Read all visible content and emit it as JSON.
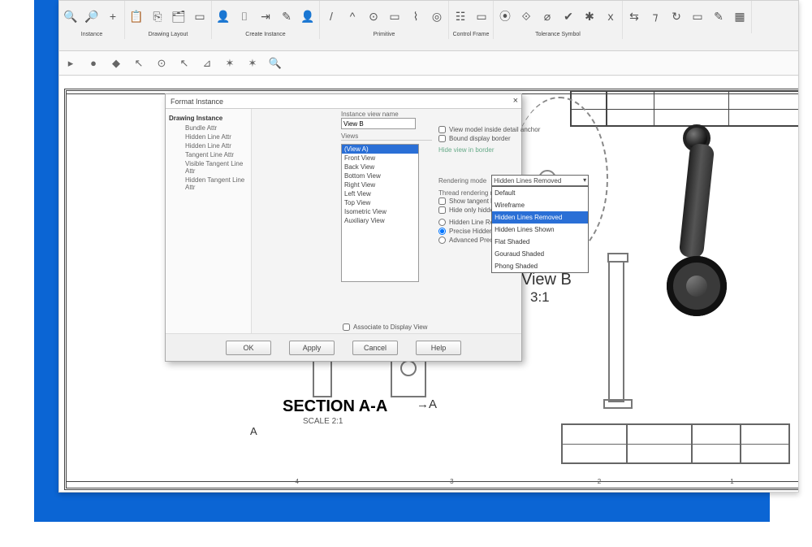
{
  "ribbon": {
    "groups": [
      {
        "label": "Instance",
        "items": [
          "🔍",
          "🔎",
          "+"
        ]
      },
      {
        "label": "Drawing Layout",
        "items": [
          "📋",
          "⎘",
          "🗂",
          "▭"
        ]
      },
      {
        "label": "Create Instance",
        "items": [
          "👤",
          "⌷",
          "⇥",
          "✎",
          "👤"
        ]
      },
      {
        "label": "Primitive",
        "items": [
          "/",
          "^",
          "⊙",
          "▭",
          "⌇",
          "◎"
        ]
      },
      {
        "label": "Control Frame",
        "items": [
          "☷",
          "▭"
        ]
      },
      {
        "label": "Tolerance Symbol",
        "items": [
          "⦿",
          "⟐",
          "⌀",
          "✔",
          "✱",
          "x"
        ]
      },
      {
        "label": "",
        "items": [
          "⇆",
          "⁊",
          "↻",
          "▭",
          "✎",
          "▦"
        ]
      }
    ]
  },
  "subtoolbar": [
    "●",
    "◆",
    "↖",
    "⊙",
    "↖",
    "⊿",
    "✶",
    "✶",
    "🔍"
  ],
  "dialog": {
    "title": "Format Instance",
    "tree_header": "Drawing Instance",
    "tree_items": [
      "Bundle Attr",
      "Hidden Line Attr",
      "Hidden Line Attr",
      "Tangent Line Attr",
      "Visible Tangent Line Attr",
      "Hidden Tangent Line Attr"
    ],
    "instance_name_label": "Instance view name",
    "instance_name_value": "View B",
    "view_list_label": "Views",
    "view_list": [
      "(View A)",
      "Front View",
      "Back View",
      "Bottom View",
      "Right View",
      "Left View",
      "Top View",
      "Isometric View",
      "Auxiliary View"
    ],
    "top_checks": [
      "View model inside detail anchor",
      "Bound display border"
    ],
    "top_links": [
      "Hide view in border"
    ],
    "render_mode_label": "Rendering mode",
    "render_mode_value": "Hidden Lines Removed",
    "render_options": [
      "Default",
      "Wireframe",
      "Hidden Lines Removed",
      "Hidden Lines Shown",
      "Flat Shaded",
      "Gouraud Shaded",
      "Phong Shaded"
    ],
    "thread_label": "Thread rendering mode",
    "more_checks": [
      "Show tangent lines",
      "Hide only hidden"
    ],
    "radios": [
      "Hidden Line Rendering",
      "Precise Hidden Line Rendering",
      "Advanced Precise Hidden Line Rendering"
    ],
    "associate_check": "Associate to Display View",
    "buttons": {
      "ok": "OK",
      "apply": "Apply",
      "cancel": "Cancel",
      "help": "Help"
    }
  },
  "drawing": {
    "viewb": "View B",
    "viewb_scale": "3:1",
    "section": "SECTION  A-A",
    "section_scale": "SCALE 2:1",
    "arrowA": "→A",
    "sideA": "A",
    "bottom_numbers": [
      "4",
      "3",
      "2",
      "1"
    ]
  }
}
